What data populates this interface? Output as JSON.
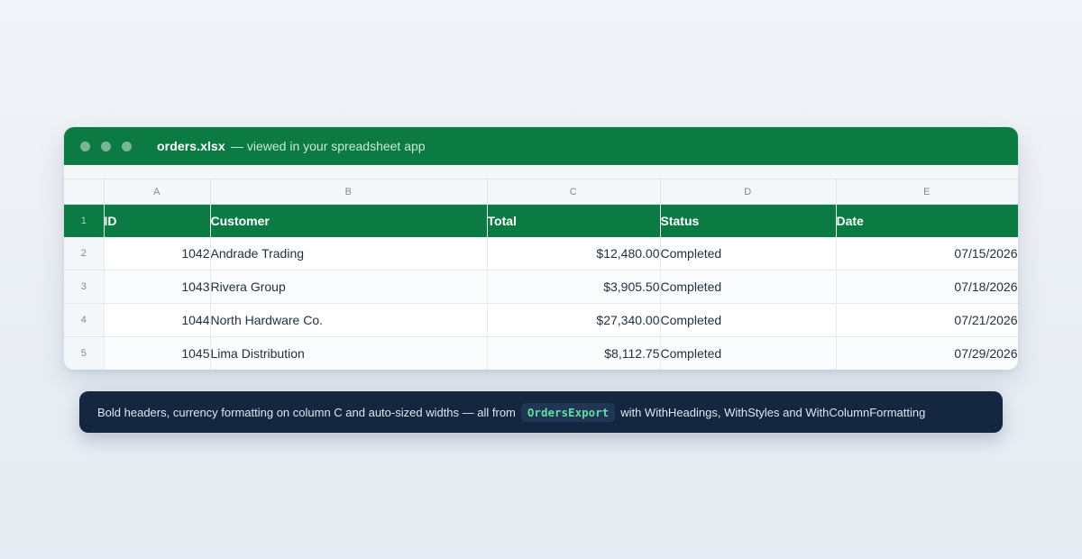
{
  "window": {
    "file_name": "orders.xlsx",
    "subtitle": "— viewed in your spreadsheet app"
  },
  "sheet": {
    "column_letters": [
      "A",
      "B",
      "C",
      "D",
      "E"
    ],
    "header_row_number": "1",
    "headers": [
      "ID",
      "Customer",
      "Total",
      "Status",
      "Date"
    ],
    "rows": [
      {
        "row_number": "2",
        "cells": [
          "1042",
          "Andrade Trading",
          "$12,480.00",
          "Completed",
          "07/15/2026"
        ]
      },
      {
        "row_number": "3",
        "cells": [
          "1043",
          "Rivera Group",
          "$3,905.50",
          "Completed",
          "07/18/2026"
        ]
      },
      {
        "row_number": "4",
        "cells": [
          "1044",
          "North Hardware Co.",
          "$27,340.00",
          "Completed",
          "07/21/2026"
        ]
      },
      {
        "row_number": "5",
        "cells": [
          "1045",
          "Lima Distribution",
          "$8,112.75",
          "Completed",
          "07/29/2026"
        ]
      }
    ]
  },
  "caption": {
    "before": "Bold headers, currency formatting on column C and auto-sized widths — all from",
    "code": "OrdersExport",
    "after": "with WithHeadings, WithStyles and WithColumnFormatting"
  },
  "colors": {
    "brand_green": "#0b7a43",
    "caption_bg": "#142640",
    "code_text": "#5fe0a0"
  }
}
